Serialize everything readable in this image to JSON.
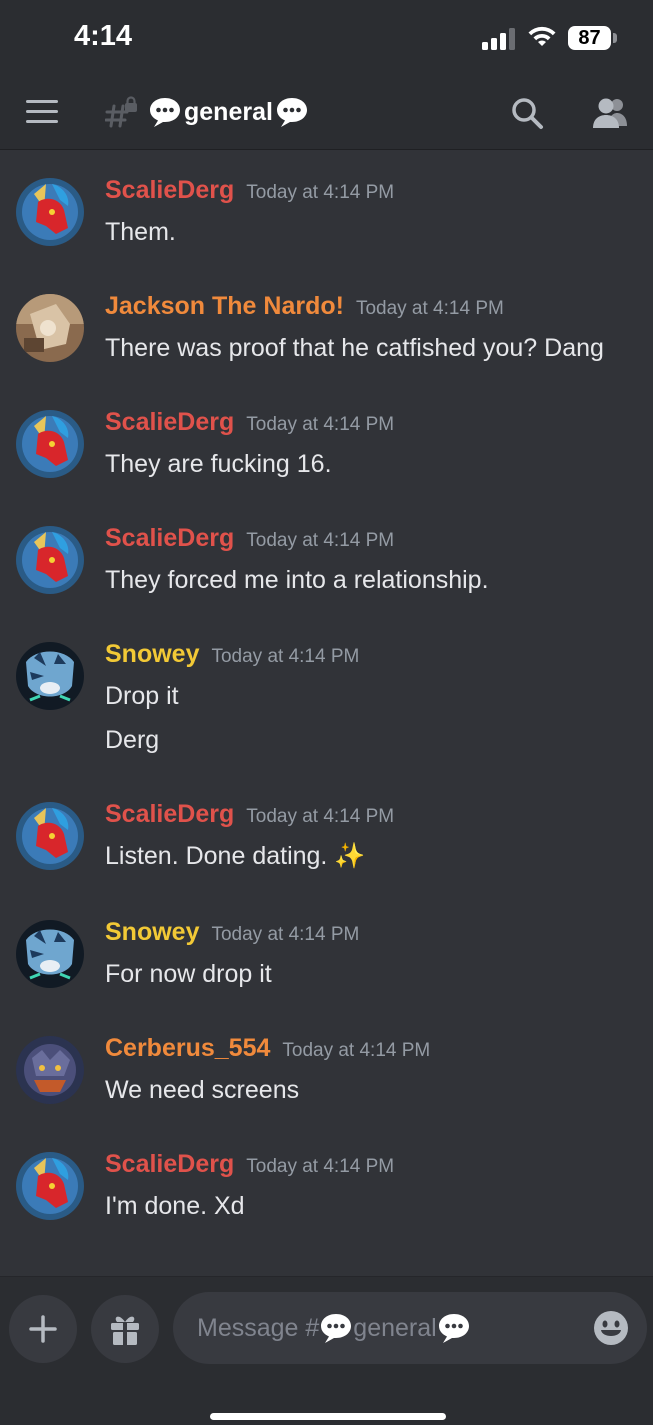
{
  "status_bar": {
    "time": "4:14",
    "battery": "87"
  },
  "header": {
    "channel_name": "general"
  },
  "messages": [
    {
      "author": "ScalieDerg",
      "timestamp": "Today at 4:14 PM",
      "lines": [
        "Them."
      ],
      "color": "#e0524b"
    },
    {
      "author": "Jackson The Nardo!",
      "timestamp": "Today at 4:14 PM",
      "lines": [
        "There was proof that he catfished you? Dang"
      ],
      "color": "#f08a3c"
    },
    {
      "author": "ScalieDerg",
      "timestamp": "Today at 4:14 PM",
      "lines": [
        "They are fucking 16."
      ],
      "color": "#e0524b"
    },
    {
      "author": "ScalieDerg",
      "timestamp": "Today at 4:14 PM",
      "lines": [
        "They forced me into a relationship."
      ],
      "color": "#e0524b"
    },
    {
      "author": "Snowey",
      "timestamp": "Today at 4:14 PM",
      "lines": [
        "Drop it",
        "Derg"
      ],
      "color": "#f2c936"
    },
    {
      "author": "ScalieDerg",
      "timestamp": "Today at 4:14 PM",
      "lines": [
        "Listen. Done dating. ✨"
      ],
      "color": "#e0524b"
    },
    {
      "author": "Snowey",
      "timestamp": "Today at 4:14 PM",
      "lines": [
        "For now drop it"
      ],
      "color": "#f2c936"
    },
    {
      "author": "Cerberus_554",
      "timestamp": "Today at 4:14 PM",
      "lines": [
        "We need screens"
      ],
      "color": "#f08a3c"
    },
    {
      "author": "ScalieDerg",
      "timestamp": "Today at 4:14 PM",
      "lines": [
        "I'm done. Xd"
      ],
      "color": "#e0524b"
    }
  ],
  "composer": {
    "placeholder_prefix": "Message #",
    "placeholder_channel": "general"
  },
  "icons": {
    "menu": "hamburger-icon",
    "channel": "locked-hash-icon",
    "bubble": "speech-bubble-emoji",
    "search": "search-icon",
    "members": "members-icon",
    "plus": "plus-icon",
    "gift": "gift-icon",
    "emoji": "emoji-icon"
  }
}
